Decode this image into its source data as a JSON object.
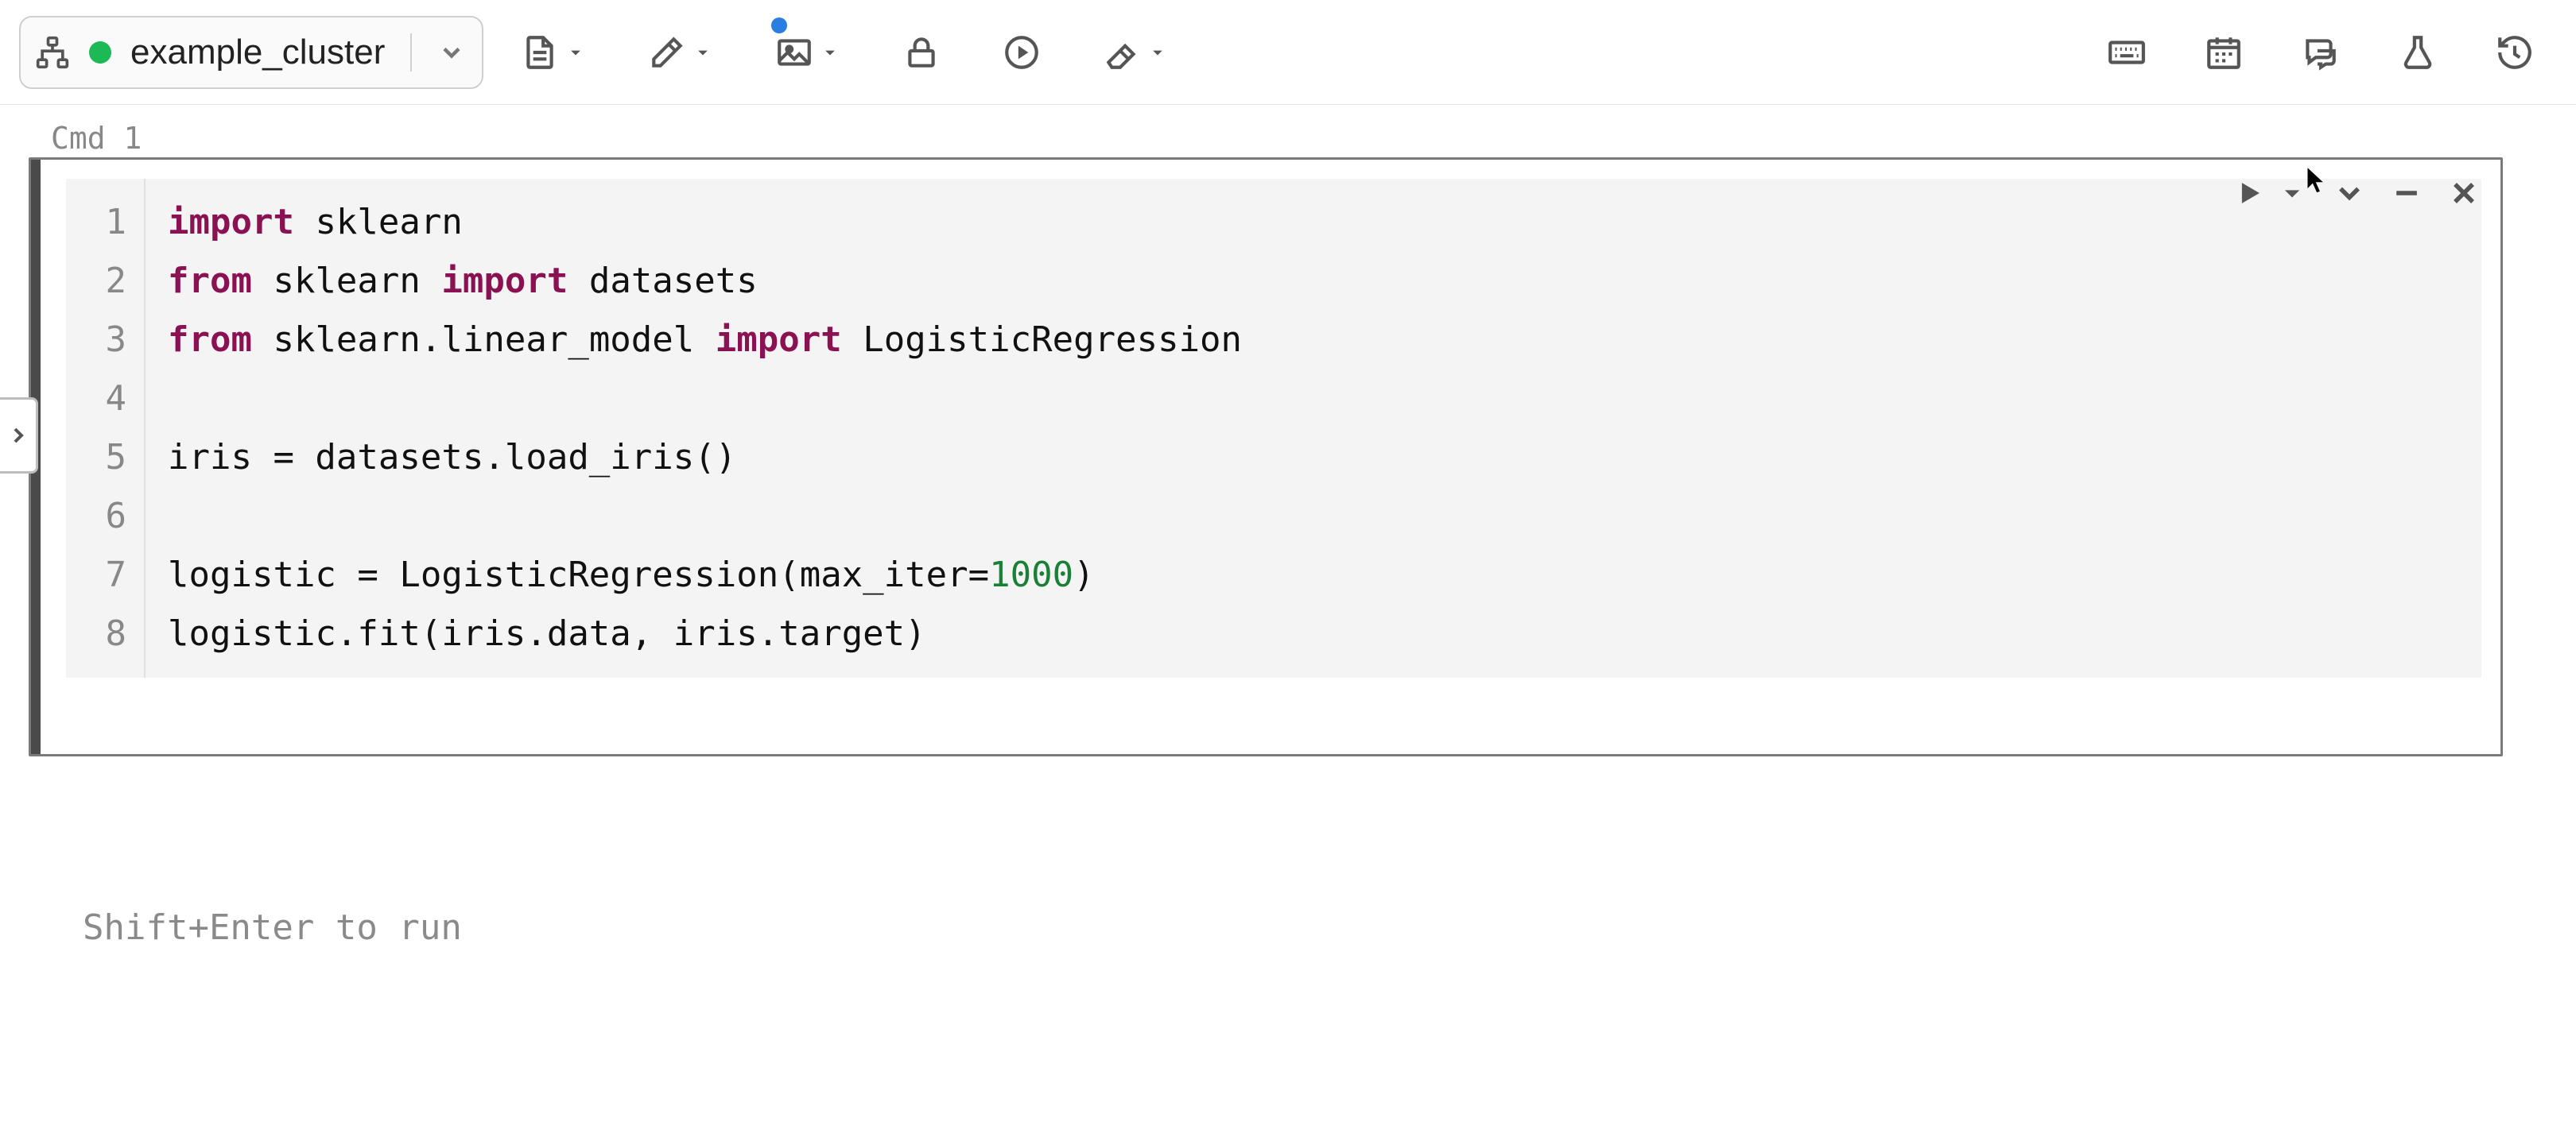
{
  "toolbar": {
    "cluster_name": "example_cluster",
    "cluster_status": "running",
    "cluster_status_color": "#1db954"
  },
  "cell": {
    "label": "Cmd 1",
    "hint": "Shift+Enter to run",
    "code_lines": [
      [
        {
          "t": "import",
          "c": "kw"
        },
        {
          "t": " sklearn"
        }
      ],
      [
        {
          "t": "from",
          "c": "kw"
        },
        {
          "t": " sklearn "
        },
        {
          "t": "import",
          "c": "kw"
        },
        {
          "t": " datasets"
        }
      ],
      [
        {
          "t": "from",
          "c": "kw"
        },
        {
          "t": " sklearn.linear_model "
        },
        {
          "t": "import",
          "c": "kw"
        },
        {
          "t": " LogisticRegression"
        }
      ],
      [
        {
          "t": ""
        }
      ],
      [
        {
          "t": "iris = datasets.load_iris()"
        }
      ],
      [
        {
          "t": ""
        }
      ],
      [
        {
          "t": "logistic = LogisticRegression(max_iter="
        },
        {
          "t": "1000",
          "c": "num"
        },
        {
          "t": ")"
        }
      ],
      [
        {
          "t": "logistic.fit(iris.data, iris.target)"
        }
      ]
    ],
    "line_numbers": [
      "1",
      "2",
      "3",
      "4",
      "5",
      "6",
      "7",
      "8"
    ]
  },
  "icons": {
    "hierarchy": "hierarchy-icon",
    "file": "file-icon",
    "edit": "edit-icon",
    "image": "image-icon",
    "lock": "lock-icon",
    "run_all": "run-all-icon",
    "clear": "clear-icon",
    "keyboard": "keyboard-icon",
    "schedule": "schedule-icon",
    "comments": "comments-icon",
    "experiments": "experiments-icon",
    "revision": "revision-icon",
    "run_cell": "run-cell-icon",
    "caret_down": "caret-down-icon",
    "chevron_down": "chevron-down-icon",
    "minimize": "minimize-icon",
    "close": "close-icon",
    "expand": "expand-right-icon"
  }
}
